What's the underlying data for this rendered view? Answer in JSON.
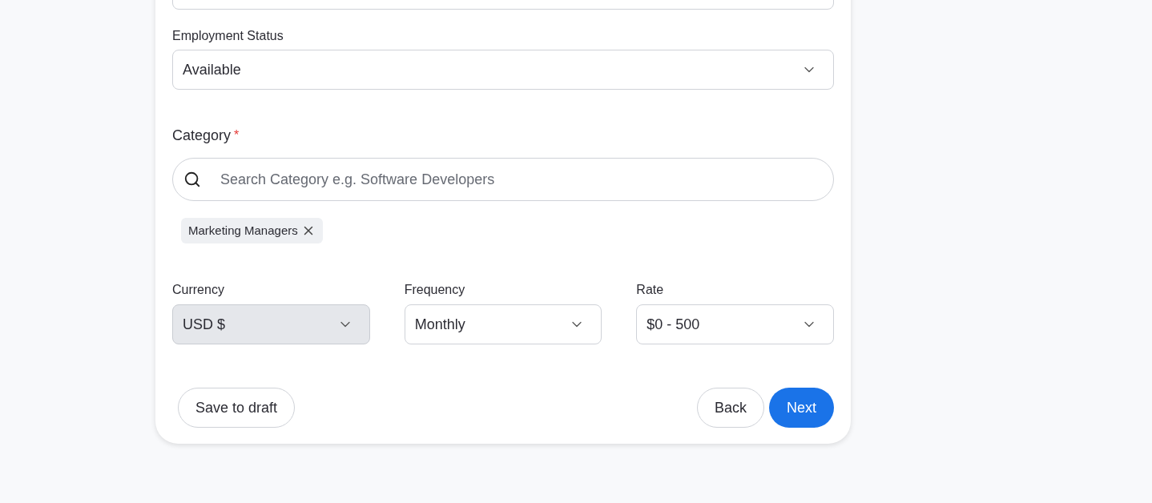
{
  "employment_status": {
    "label": "Employment Status",
    "value": "Available"
  },
  "category": {
    "label": "Category",
    "required_mark": "*",
    "search_placeholder": "Search Category e.g. Software Developers",
    "tags": [
      {
        "label": "Marketing Managers"
      }
    ]
  },
  "selects": [
    {
      "label": "Currency",
      "value": "USD $",
      "disabled": true
    },
    {
      "label": "Frequency",
      "value": "Monthly",
      "disabled": false
    },
    {
      "label": "Rate",
      "value": "$0 - 500",
      "disabled": false
    }
  ],
  "buttons": {
    "draft": "Save to draft",
    "back": "Back",
    "next": "Next"
  }
}
